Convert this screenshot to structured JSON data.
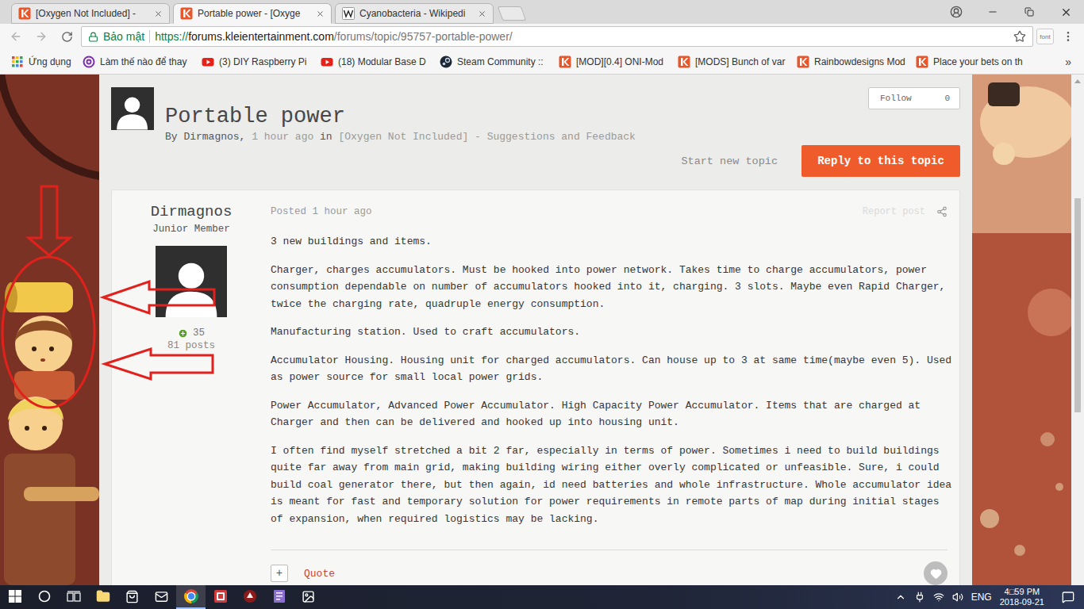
{
  "browser": {
    "tabs": [
      {
        "label": "[Oxygen Not Included] -",
        "kind": "klei",
        "selected": false
      },
      {
        "label": "Portable power - [Oxyge",
        "kind": "klei",
        "selected": true
      },
      {
        "label": "Cyanobacteria - Wikipedi",
        "kind": "wiki",
        "selected": false
      }
    ],
    "nav": {
      "back_disabled": true,
      "forward_disabled": true
    },
    "omnibox": {
      "security": "Bảo mật",
      "scheme": "https://",
      "host": "forums.kleientertainment.com",
      "path": "/forums/topic/95757-portable-power/",
      "starred": false
    },
    "extension": "font",
    "bookmarks": [
      {
        "label": "Ứng dụng",
        "kind": "apps"
      },
      {
        "label": "Làm thế nào để thay",
        "kind": "quora"
      },
      {
        "label": "(3) DIY Raspberry Pi",
        "kind": "youtube"
      },
      {
        "label": "(18) Modular Base D",
        "kind": "youtube"
      },
      {
        "label": "Steam Community ::",
        "kind": "steam"
      },
      {
        "label": "[MOD][0.4] ONI-Mod",
        "kind": "klei"
      },
      {
        "label": "[MODS] Bunch of var",
        "kind": "klei"
      },
      {
        "label": "Rainbowdesigns Mod",
        "kind": "klei"
      },
      {
        "label": "Place your bets on th",
        "kind": "klei"
      }
    ],
    "bookmarks_more": "»"
  },
  "topic": {
    "title": "Portable power",
    "byline": [
      {
        "text": "By Dirmagnos,",
        "muted": false
      },
      {
        "text": "1 hour ago",
        "muted": true
      },
      {
        "text": "in",
        "muted": false
      },
      {
        "text": "[Oxygen Not Included] - Suggestions and Feedback",
        "muted": true
      }
    ],
    "follow": {
      "label": "Follow",
      "count": "0"
    },
    "start_new_topic": "Start new topic",
    "reply": "Reply to this topic"
  },
  "post": {
    "author": "Dirmagnos",
    "rank": "Junior Member",
    "reputation": "35",
    "posts": "81 posts",
    "posted": "Posted 1 hour ago",
    "report": "Report post",
    "paragraphs": [
      "3 new buildings and items.",
      "Charger, charges accumulators. Must be hooked into power network. Takes time to charge accumulators, power consumption dependable on number of accumulators hooked into it, charging. 3 slots. Maybe even Rapid Charger, twice the charging rate, quadruple energy consumption.",
      "Manufacturing station. Used to craft accumulators.",
      "Accumulator Housing. Housing unit for charged accumulators. Can house up to 3 at same time(maybe even 5). Used as power source for small local power grids.",
      "Power Accumulator, Advanced Power Accumulator. High Capacity Power Accumulator. Items that are charged at Charger and then can be delivered and hooked up into housing unit.",
      "I often find myself stretched a bit 2 far, especially in terms of power. Sometimes i need to build buildings quite far away from main grid, making building wiring either overly complicated or unfeasible. Sure, i could build coal generator there, but then again, id need batteries and whole infrastructure. Whole accumulator idea is meant for fast and temporary solution for power requirements in remote parts of map during initial stages of expansion, when required logistics may be lacking."
    ],
    "multiquote": "+",
    "quote": "Quote",
    "liked": false
  },
  "taskbar": {
    "apps": [
      {
        "kind": "explorer",
        "active": false
      },
      {
        "kind": "store",
        "active": false
      },
      {
        "kind": "mail",
        "active": false
      },
      {
        "kind": "chrome",
        "active": true
      },
      {
        "kind": "app-red",
        "active": false
      },
      {
        "kind": "app-game",
        "active": false
      },
      {
        "kind": "app-notes",
        "active": false
      },
      {
        "kind": "photos",
        "active": false
      }
    ],
    "language": "ENG",
    "time": "4□59 PM",
    "date": "2018-09-21"
  }
}
